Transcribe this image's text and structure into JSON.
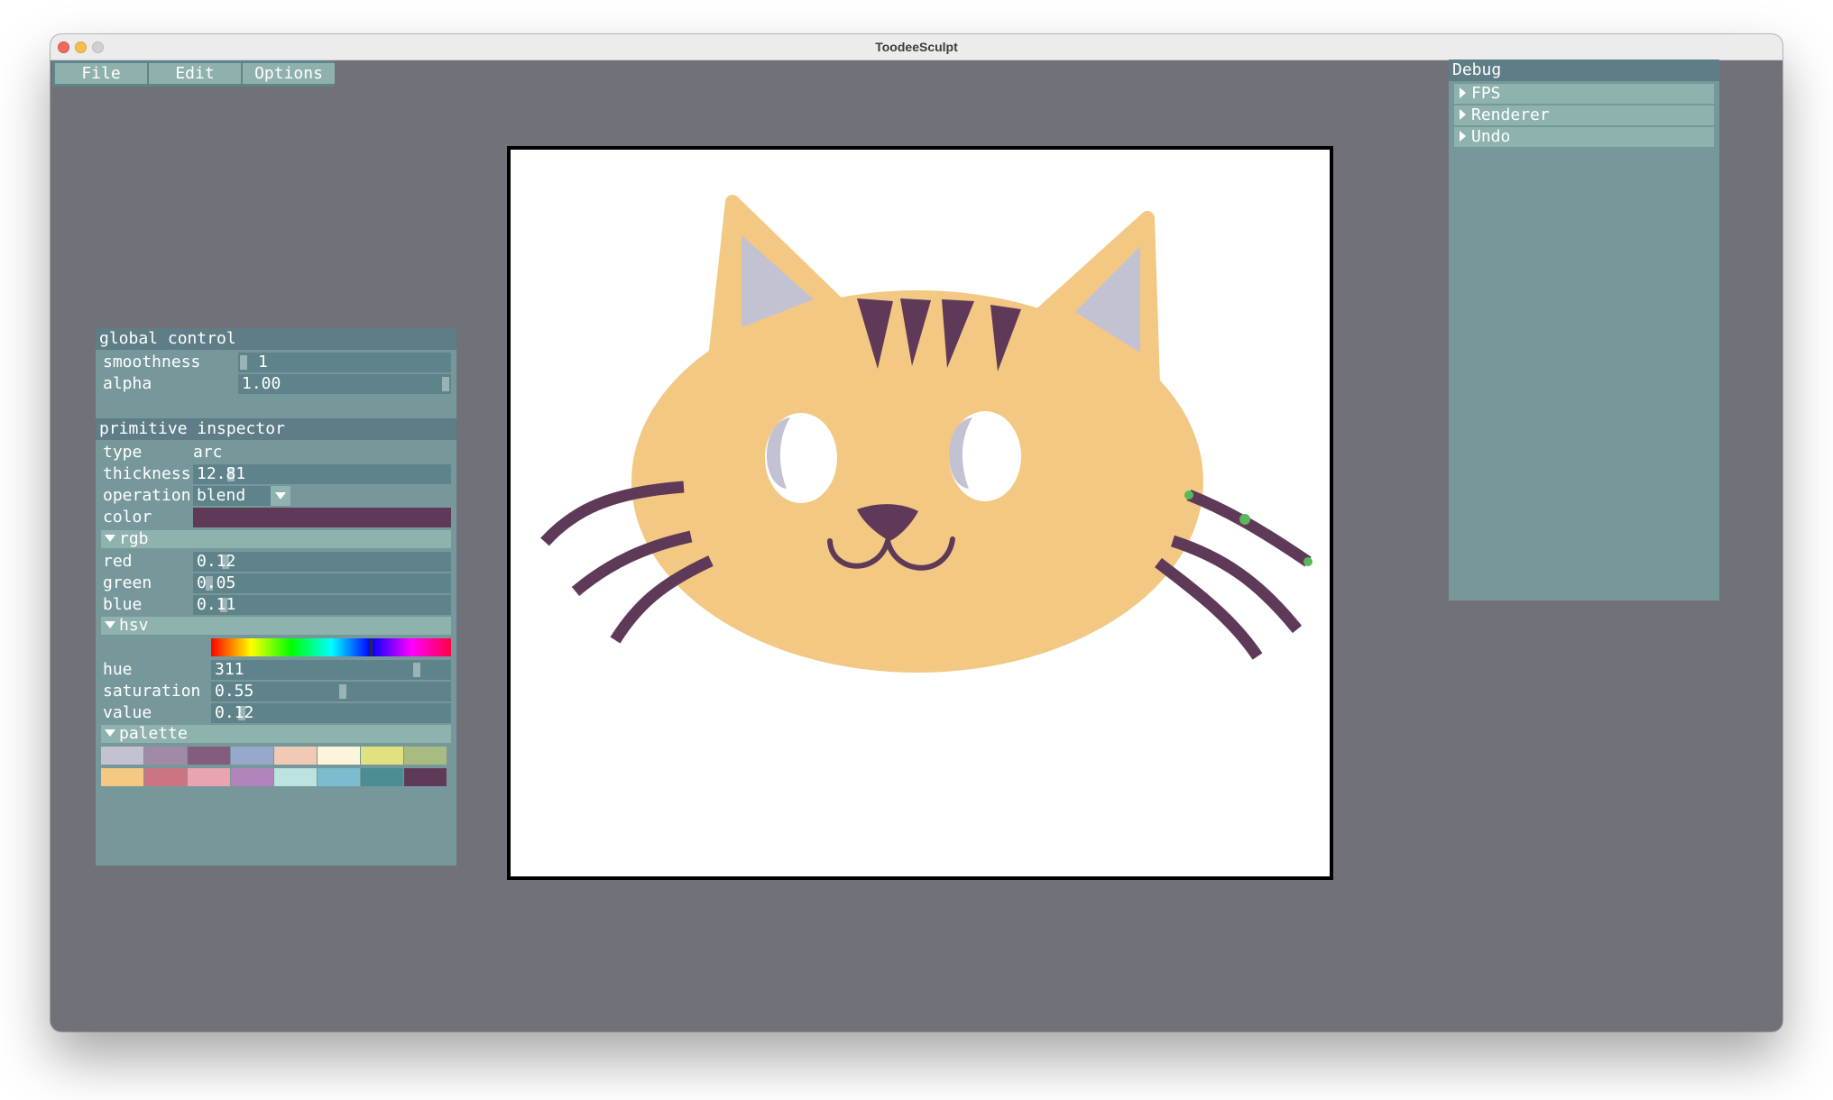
{
  "window": {
    "title": "ToodeeSculpt"
  },
  "menubar": {
    "items": [
      "File",
      "Edit",
      "Options"
    ]
  },
  "global_control": {
    "title": "global control",
    "smoothness_label": "smoothness",
    "smoothness_value": "1",
    "alpha_label": "alpha",
    "alpha_value": "1.00"
  },
  "inspector": {
    "title": "primitive inspector",
    "type_label": "type",
    "type_value": "arc",
    "thickness_label": "thickness",
    "thickness_value": "12.81",
    "operation_label": "operation",
    "operation_value": "blend",
    "color_label": "color",
    "color_hex": "#5f3a58",
    "rgb": {
      "header": "rgb",
      "red_label": "red",
      "red_value": "0.12",
      "green_label": "green",
      "green_value": "0.05",
      "blue_label": "blue",
      "blue_value": "0.11"
    },
    "hsv": {
      "header": "hsv",
      "hue_label": "hue",
      "hue_value": "311",
      "saturation_label": "saturation",
      "saturation_value": "0.55",
      "value_label": "value",
      "value_value": "0.12"
    },
    "palette": {
      "header": "palette",
      "row1": [
        "#c2c2d3",
        "#a18aa5",
        "#845d7c",
        "#97a8cd",
        "#f0cab4",
        "#fbf5dc",
        "#e1e17f",
        "#a8bb81"
      ],
      "row2": [
        "#f4c984",
        "#cb7583",
        "#e9a4b0",
        "#b384bb",
        "#bce3df",
        "#7bbcce",
        "#4b8d92",
        "#5f3a58"
      ]
    }
  },
  "debug": {
    "title": "Debug",
    "items": [
      "FPS",
      "Renderer",
      "Undo"
    ]
  },
  "colors": {
    "background": "#71717a",
    "panel": "#77989b",
    "header": "#5f7d86",
    "cat_body": "#f2c883",
    "cat_ear_inner": "#c2c2d3",
    "cat_features": "#5f3a58",
    "handle": "#58b85a"
  }
}
